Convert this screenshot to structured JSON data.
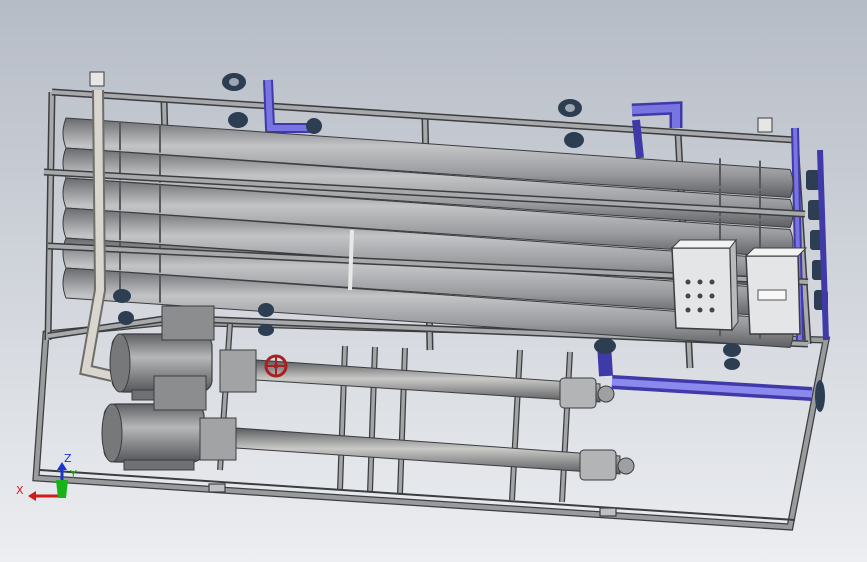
{
  "colors": {
    "background_top": "#b6bcc6",
    "background_bottom": "#eceef1",
    "frame_steel": "#8e9093",
    "frame_edge": "#3c3d40",
    "vessel_gray": "#9a9b9e",
    "vessel_highlight": "#c3c4c6",
    "vessel_shadow": "#6a6b6e",
    "pipe_blue": "#6b67d6",
    "pipe_blue_dark": "#3f3aa8",
    "pipe_white": "#d8d6cf",
    "flange_dark": "#2d3e52",
    "valve_red": "#a82020",
    "motor_gray": "#8a8b8d",
    "panel_white": "#e4e5e6",
    "axis_x": "#d11a1a",
    "axis_y": "#19b319",
    "axis_z": "#1a36d1"
  },
  "triad": {
    "x_label": "X",
    "y_label": "Y",
    "z_label": "Z",
    "x_icon": "x-axis-arrow-icon",
    "y_icon": "y-axis-arrow-icon",
    "z_icon": "z-axis-arrow-icon"
  },
  "components": {
    "vessel_count": 6,
    "pump_count": 2,
    "control_panel_count": 2
  }
}
